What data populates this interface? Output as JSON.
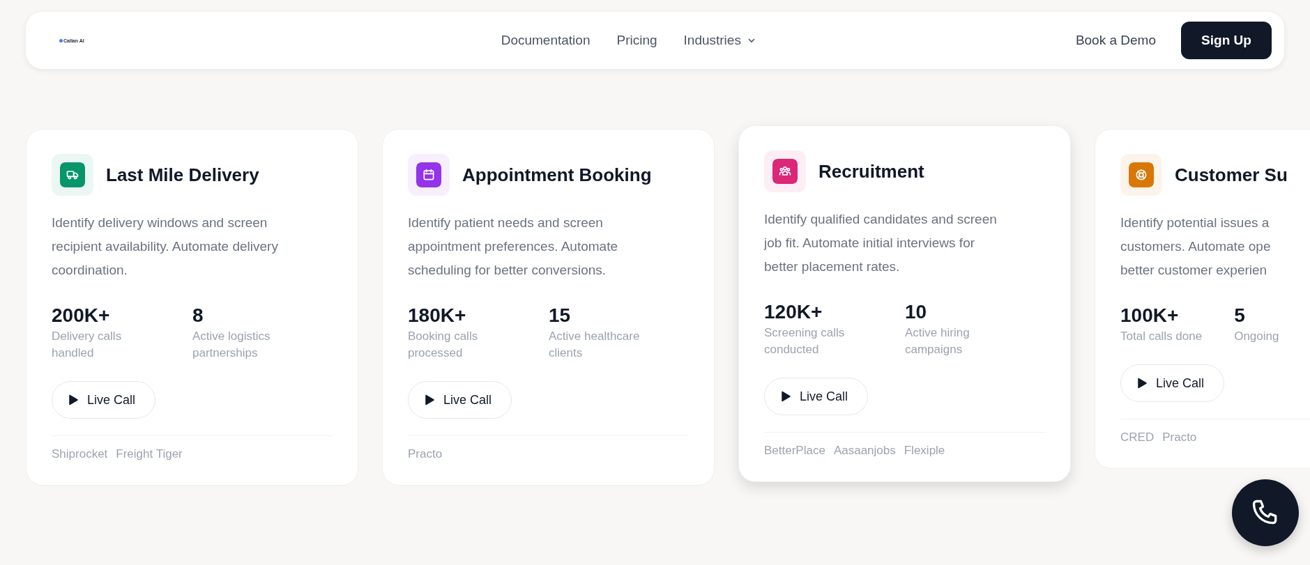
{
  "nav": {
    "logo": "Callan AI",
    "links": [
      {
        "label": "Documentation",
        "kind": "link"
      },
      {
        "label": "Pricing",
        "kind": "link"
      },
      {
        "label": "Industries",
        "kind": "dropdown"
      }
    ],
    "demo": "Book a Demo",
    "signup": "Sign Up"
  },
  "cards": [
    {
      "kind": "truck",
      "color": "#059669",
      "title": "Last Mile Delivery",
      "highlighted": false,
      "description": [
        "Identify delivery windows and screen",
        "recipient availability. Automate delivery",
        "coordination."
      ],
      "stats": [
        {
          "value": "200K+",
          "label": "Delivery calls handled"
        },
        {
          "value": "8",
          "label": "Active logistics partnerships"
        }
      ],
      "button": "Live Call",
      "partners": [
        "Shiprocket",
        "Freight Tiger"
      ]
    },
    {
      "kind": "calendar",
      "color": "#9333ea",
      "title": "Appointment Booking",
      "highlighted": false,
      "description": [
        "Identify patient needs and screen",
        "appointment preferences. Automate",
        "scheduling for better conversions."
      ],
      "stats": [
        {
          "value": "180K+",
          "label": "Booking calls processed"
        },
        {
          "value": "15",
          "label": "Active healthcare clients"
        }
      ],
      "button": "Live Call",
      "partners": [
        "Practo"
      ]
    },
    {
      "kind": "people",
      "color": "#db2777",
      "title": "Recruitment",
      "highlighted": true,
      "description": [
        "Identify qualified candidates and screen",
        "job fit. Automate initial interviews for",
        "better placement rates."
      ],
      "stats": [
        {
          "value": "120K+",
          "label": "Screening calls conducted"
        },
        {
          "value": "10",
          "label": "Active hiring campaigns"
        }
      ],
      "button": "Live Call",
      "partners": [
        "BetterPlace",
        "Aasaanjobs",
        "Flexiple"
      ]
    },
    {
      "kind": "lifebuoy",
      "color": "#d97706",
      "title": "Customer Su",
      "highlighted": false,
      "description": [
        "Identify potential issues a",
        "customers. Automate ope",
        "better customer experien"
      ],
      "stats": [
        {
          "value": "100K+",
          "label": "Total calls done"
        },
        {
          "value": "5",
          "label": "Ongoing"
        }
      ],
      "button": "Live Call",
      "partners": [
        "CRED",
        "Practo"
      ]
    }
  ]
}
